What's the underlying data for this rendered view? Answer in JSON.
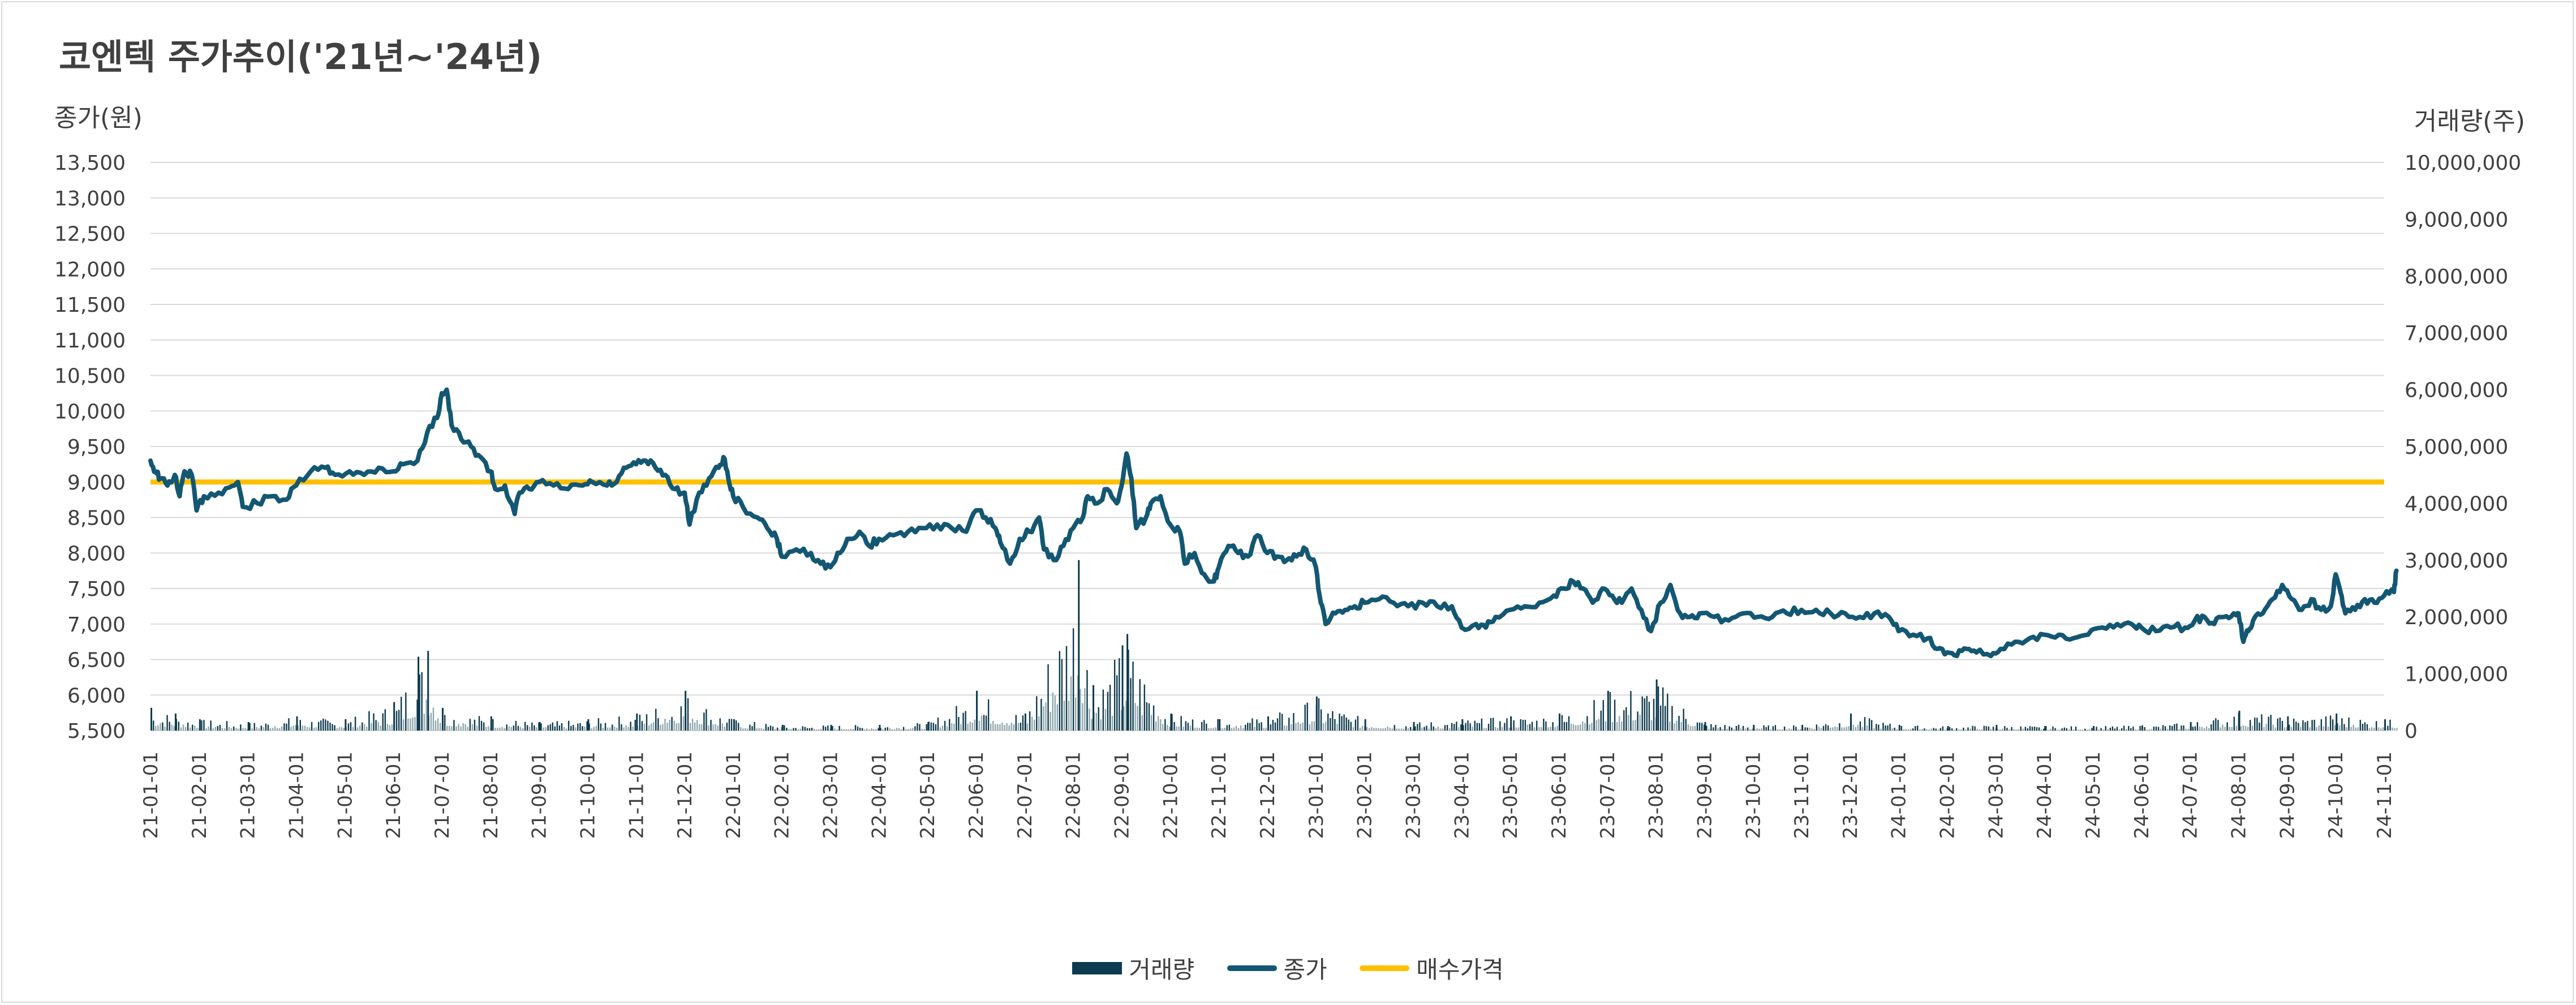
{
  "chart_data": {
    "type": "line",
    "title": "코엔텍 주가추이('21년~'24년)",
    "y_left_label": "종가(원)",
    "y_right_label": "거래량(주)",
    "y_left_range": [
      5500,
      13500
    ],
    "y_right_range": [
      0,
      10000000
    ],
    "y_left_ticks": [
      "13,500",
      "13,000",
      "12,500",
      "12,000",
      "11,500",
      "11,000",
      "10,500",
      "10,000",
      "9,500",
      "9,000",
      "8,500",
      "8,000",
      "7,500",
      "7,000",
      "6,500",
      "6,000",
      "5,500"
    ],
    "y_right_ticks": [
      "10,000,000",
      "9,000,000",
      "8,000,000",
      "7,000,000",
      "6,000,000",
      "5,000,000",
      "4,000,000",
      "3,000,000",
      "2,000,000",
      "1,000,000",
      "0"
    ],
    "x_labels": [
      "21-01-01",
      "21-02-01",
      "21-03-01",
      "21-04-01",
      "21-05-01",
      "21-06-01",
      "21-07-01",
      "21-08-01",
      "21-09-01",
      "21-10-01",
      "21-11-01",
      "21-12-01",
      "22-01-01",
      "22-02-01",
      "22-03-01",
      "22-04-01",
      "22-05-01",
      "22-06-01",
      "22-07-01",
      "22-08-01",
      "22-09-01",
      "22-10-01",
      "22-11-01",
      "22-12-01",
      "23-01-01",
      "23-02-01",
      "23-03-01",
      "23-04-01",
      "23-05-01",
      "23-06-01",
      "23-07-01",
      "23-08-01",
      "23-09-01",
      "23-10-01",
      "23-11-01",
      "23-12-01",
      "24-01-01",
      "24-02-01",
      "24-03-01",
      "24-04-01",
      "24-05-01",
      "24-06-01",
      "24-07-01",
      "24-08-01",
      "24-09-01",
      "24-10-01",
      "24-11-01"
    ],
    "grid": true,
    "legend_position": "bottom",
    "series": [
      {
        "name": "거래량",
        "axis": "right",
        "type": "bar",
        "color": "#0d3a4e",
        "note_points": [
          [
            0,
            400000
          ],
          [
            0.5,
            300000
          ],
          [
            1,
            200000
          ],
          [
            2,
            150000
          ],
          [
            3,
            250000
          ],
          [
            4,
            200000
          ],
          [
            5,
            500000
          ],
          [
            5.5,
            1300000
          ],
          [
            5.7,
            1400000
          ],
          [
            6,
            400000
          ],
          [
            7,
            250000
          ],
          [
            8,
            150000
          ],
          [
            9,
            200000
          ],
          [
            10,
            300000
          ],
          [
            11,
            700000
          ],
          [
            12,
            200000
          ],
          [
            13,
            100000
          ],
          [
            14,
            100000
          ],
          [
            15,
            100000
          ],
          [
            16,
            150000
          ],
          [
            17,
            700000
          ],
          [
            18,
            300000
          ],
          [
            19.1,
            3000000
          ],
          [
            19.4,
            800000
          ],
          [
            20,
            1500000
          ],
          [
            20.1,
            1700000
          ],
          [
            21,
            300000
          ],
          [
            22,
            200000
          ],
          [
            23,
            250000
          ],
          [
            24,
            600000
          ],
          [
            25,
            200000
          ],
          [
            26,
            150000
          ],
          [
            27,
            200000
          ],
          [
            28,
            250000
          ],
          [
            29,
            300000
          ],
          [
            30,
            700000
          ],
          [
            31,
            900000
          ],
          [
            32,
            150000
          ],
          [
            33,
            100000
          ],
          [
            34,
            100000
          ],
          [
            35,
            300000
          ],
          [
            36,
            100000
          ],
          [
            37,
            80000
          ],
          [
            38,
            100000
          ],
          [
            39,
            80000
          ],
          [
            40,
            80000
          ],
          [
            41,
            90000
          ],
          [
            42,
            150000
          ],
          [
            43,
            350000
          ],
          [
            44,
            250000
          ],
          [
            45,
            300000
          ],
          [
            46,
            200000
          ]
        ]
      },
      {
        "name": "종가",
        "axis": "left",
        "type": "line",
        "color": "#135773",
        "points": [
          [
            0,
            9300
          ],
          [
            0.1,
            9150
          ],
          [
            0.2,
            9050
          ],
          [
            0.35,
            8950
          ],
          [
            0.5,
            9100
          ],
          [
            0.6,
            8800
          ],
          [
            0.7,
            9150
          ],
          [
            0.85,
            9100
          ],
          [
            0.95,
            8600
          ],
          [
            1.1,
            8800
          ],
          [
            1.4,
            8850
          ],
          [
            1.7,
            8950
          ],
          [
            1.8,
            9000
          ],
          [
            1.9,
            8650
          ],
          [
            2.2,
            8700
          ],
          [
            2.5,
            8800
          ],
          [
            2.8,
            8750
          ],
          [
            3,
            8950
          ],
          [
            3.3,
            9150
          ],
          [
            3.6,
            9200
          ],
          [
            3.8,
            9100
          ],
          [
            4.1,
            9150
          ],
          [
            4.4,
            9100
          ],
          [
            4.7,
            9200
          ],
          [
            5,
            9150
          ],
          [
            5.2,
            9250
          ],
          [
            5.5,
            9300
          ],
          [
            5.7,
            9700
          ],
          [
            5.9,
            9900
          ],
          [
            6,
            10250
          ],
          [
            6.1,
            10300
          ],
          [
            6.2,
            9800
          ],
          [
            6.4,
            9600
          ],
          [
            6.6,
            9500
          ],
          [
            6.8,
            9350
          ],
          [
            7,
            9150
          ],
          [
            7.1,
            8900
          ],
          [
            7.3,
            8950
          ],
          [
            7.5,
            8550
          ],
          [
            7.6,
            8850
          ],
          [
            7.8,
            8900
          ],
          [
            8,
            9000
          ],
          [
            8.3,
            8950
          ],
          [
            8.6,
            8900
          ],
          [
            8.9,
            8950
          ],
          [
            9.1,
            9000
          ],
          [
            9.4,
            8950
          ],
          [
            9.6,
            9000
          ],
          [
            9.8,
            9200
          ],
          [
            10,
            9250
          ],
          [
            10.2,
            9300
          ],
          [
            10.4,
            9200
          ],
          [
            10.6,
            9100
          ],
          [
            10.8,
            8900
          ],
          [
            11,
            8850
          ],
          [
            11.1,
            8400
          ],
          [
            11.3,
            8850
          ],
          [
            11.5,
            9050
          ],
          [
            11.7,
            9200
          ],
          [
            11.8,
            9350
          ],
          [
            11.9,
            9050
          ],
          [
            12,
            8800
          ],
          [
            12.2,
            8650
          ],
          [
            12.5,
            8500
          ],
          [
            12.7,
            8350
          ],
          [
            12.9,
            8200
          ],
          [
            13,
            7950
          ],
          [
            13.3,
            8050
          ],
          [
            13.6,
            8000
          ],
          [
            13.8,
            7850
          ],
          [
            14,
            7800
          ],
          [
            14.2,
            8000
          ],
          [
            14.4,
            8200
          ],
          [
            14.6,
            8300
          ],
          [
            14.8,
            8100
          ],
          [
            15,
            8200
          ],
          [
            15.3,
            8250
          ],
          [
            15.6,
            8300
          ],
          [
            15.9,
            8350
          ],
          [
            16.2,
            8400
          ],
          [
            16.5,
            8350
          ],
          [
            16.8,
            8300
          ],
          [
            17,
            8600
          ],
          [
            17.2,
            8500
          ],
          [
            17.4,
            8350
          ],
          [
            17.5,
            8150
          ],
          [
            17.7,
            7850
          ],
          [
            17.9,
            8200
          ],
          [
            18.1,
            8300
          ],
          [
            18.3,
            8500
          ],
          [
            18.4,
            8050
          ],
          [
            18.6,
            7900
          ],
          [
            18.8,
            8100
          ],
          [
            19,
            8350
          ],
          [
            19.2,
            8500
          ],
          [
            19.3,
            8800
          ],
          [
            19.5,
            8700
          ],
          [
            19.7,
            8900
          ],
          [
            19.9,
            8700
          ],
          [
            20,
            8950
          ],
          [
            20.1,
            9400
          ],
          [
            20.2,
            9050
          ],
          [
            20.3,
            8350
          ],
          [
            20.5,
            8500
          ],
          [
            20.6,
            8700
          ],
          [
            20.8,
            8800
          ],
          [
            21,
            8400
          ],
          [
            21.2,
            8300
          ],
          [
            21.3,
            7850
          ],
          [
            21.5,
            8000
          ],
          [
            21.7,
            7700
          ],
          [
            21.9,
            7600
          ],
          [
            22,
            7800
          ],
          [
            22.2,
            8100
          ],
          [
            22.4,
            8000
          ],
          [
            22.6,
            7950
          ],
          [
            22.8,
            8250
          ],
          [
            23,
            8000
          ],
          [
            23.2,
            7950
          ],
          [
            23.4,
            7900
          ],
          [
            23.6,
            7950
          ],
          [
            23.8,
            8050
          ],
          [
            24,
            7800
          ],
          [
            24.1,
            7300
          ],
          [
            24.2,
            7000
          ],
          [
            24.4,
            7150
          ],
          [
            24.6,
            7200
          ],
          [
            24.8,
            7250
          ],
          [
            25,
            7300
          ],
          [
            25.3,
            7350
          ],
          [
            25.6,
            7300
          ],
          [
            25.9,
            7250
          ],
          [
            26.2,
            7300
          ],
          [
            26.5,
            7250
          ],
          [
            26.8,
            7250
          ],
          [
            27,
            6950
          ],
          [
            27.3,
            7000
          ],
          [
            27.5,
            6950
          ],
          [
            27.7,
            7100
          ],
          [
            28,
            7200
          ],
          [
            28.3,
            7250
          ],
          [
            28.6,
            7300
          ],
          [
            28.9,
            7400
          ],
          [
            29.1,
            7500
          ],
          [
            29.3,
            7600
          ],
          [
            29.5,
            7500
          ],
          [
            29.7,
            7300
          ],
          [
            29.9,
            7500
          ],
          [
            30.1,
            7400
          ],
          [
            30.3,
            7300
          ],
          [
            30.5,
            7500
          ],
          [
            30.7,
            7200
          ],
          [
            30.9,
            6900
          ],
          [
            31.1,
            7300
          ],
          [
            31.3,
            7550
          ],
          [
            31.5,
            7150
          ],
          [
            31.7,
            7100
          ],
          [
            31.9,
            7150
          ],
          [
            32.2,
            7100
          ],
          [
            32.5,
            7050
          ],
          [
            32.8,
            7150
          ],
          [
            33.1,
            7100
          ],
          [
            33.4,
            7100
          ],
          [
            33.7,
            7150
          ],
          [
            34,
            7200
          ],
          [
            34.3,
            7200
          ],
          [
            34.6,
            7150
          ],
          [
            34.9,
            7150
          ],
          [
            35.2,
            7100
          ],
          [
            35.5,
            7150
          ],
          [
            35.8,
            7100
          ],
          [
            36,
            6900
          ],
          [
            36.3,
            6850
          ],
          [
            36.6,
            6800
          ],
          [
            36.8,
            6650
          ],
          [
            37,
            6600
          ],
          [
            37.2,
            6550
          ],
          [
            37.4,
            6650
          ],
          [
            37.6,
            6600
          ],
          [
            37.9,
            6550
          ],
          [
            38.1,
            6650
          ],
          [
            38.4,
            6750
          ],
          [
            38.7,
            6800
          ],
          [
            39,
            6850
          ],
          [
            39.3,
            6850
          ],
          [
            39.6,
            6800
          ],
          [
            39.9,
            6850
          ],
          [
            40.2,
            6950
          ],
          [
            40.5,
            7000
          ],
          [
            40.8,
            7000
          ],
          [
            41,
            6950
          ],
          [
            41.3,
            6900
          ],
          [
            41.6,
            6950
          ],
          [
            41.9,
            6950
          ],
          [
            42.1,
            7050
          ],
          [
            42.3,
            7100
          ],
          [
            42.5,
            7000
          ],
          [
            42.7,
            7100
          ],
          [
            42.9,
            7150
          ],
          [
            43,
            7150
          ],
          [
            43.1,
            6750
          ],
          [
            43.2,
            6900
          ],
          [
            43.3,
            7050
          ],
          [
            43.5,
            7150
          ],
          [
            43.7,
            7350
          ],
          [
            43.9,
            7550
          ],
          [
            44.1,
            7350
          ],
          [
            44.3,
            7200
          ],
          [
            44.5,
            7350
          ],
          [
            44.7,
            7200
          ],
          [
            44.9,
            7250
          ],
          [
            45,
            7700
          ],
          [
            45.1,
            7450
          ],
          [
            45.2,
            7150
          ],
          [
            45.4,
            7200
          ],
          [
            45.6,
            7350
          ],
          [
            45.8,
            7300
          ],
          [
            46,
            7400
          ],
          [
            46.2,
            7450
          ],
          [
            46.25,
            7750
          ]
        ]
      },
      {
        "name": "매수가격",
        "axis": "left",
        "type": "line",
        "color": "#ffc000",
        "value": 9000
      }
    ]
  },
  "legend": {
    "items": [
      {
        "label": "거래량",
        "color": "#0d3a4e"
      },
      {
        "label": "종가",
        "color": "#135773"
      },
      {
        "label": "매수가격",
        "color": "#ffc000"
      }
    ]
  }
}
